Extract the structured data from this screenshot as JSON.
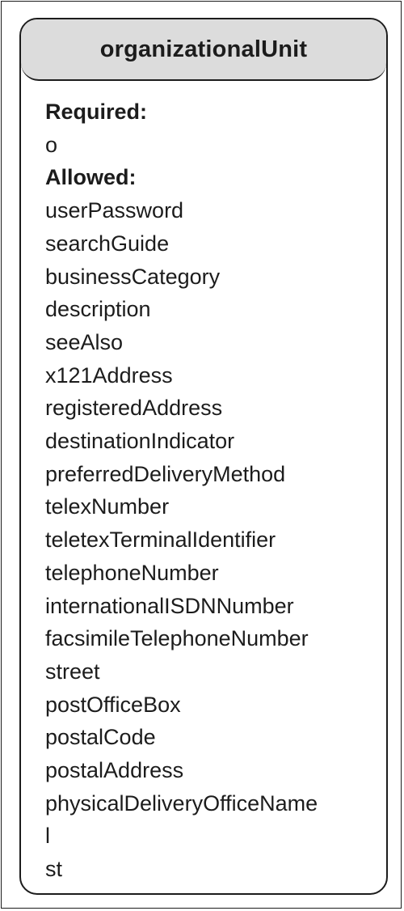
{
  "class": {
    "name": "organizationalUnit",
    "required_label": "Required:",
    "required": [
      "o"
    ],
    "allowed_label": "Allowed:",
    "allowed": [
      "userPassword",
      "searchGuide",
      "businessCategory",
      "description",
      "seeAlso",
      "x121Address",
      "registeredAddress",
      "destinationIndicator",
      "preferredDeliveryMethod",
      "telexNumber",
      "teletexTerminalIdentifier",
      "telephoneNumber",
      "internationalISDNNumber",
      "facsimileTelephoneNumber",
      "street",
      "postOfficeBox",
      "postalCode",
      "postalAddress",
      "physicalDeliveryOfficeName",
      "l",
      "st"
    ]
  }
}
